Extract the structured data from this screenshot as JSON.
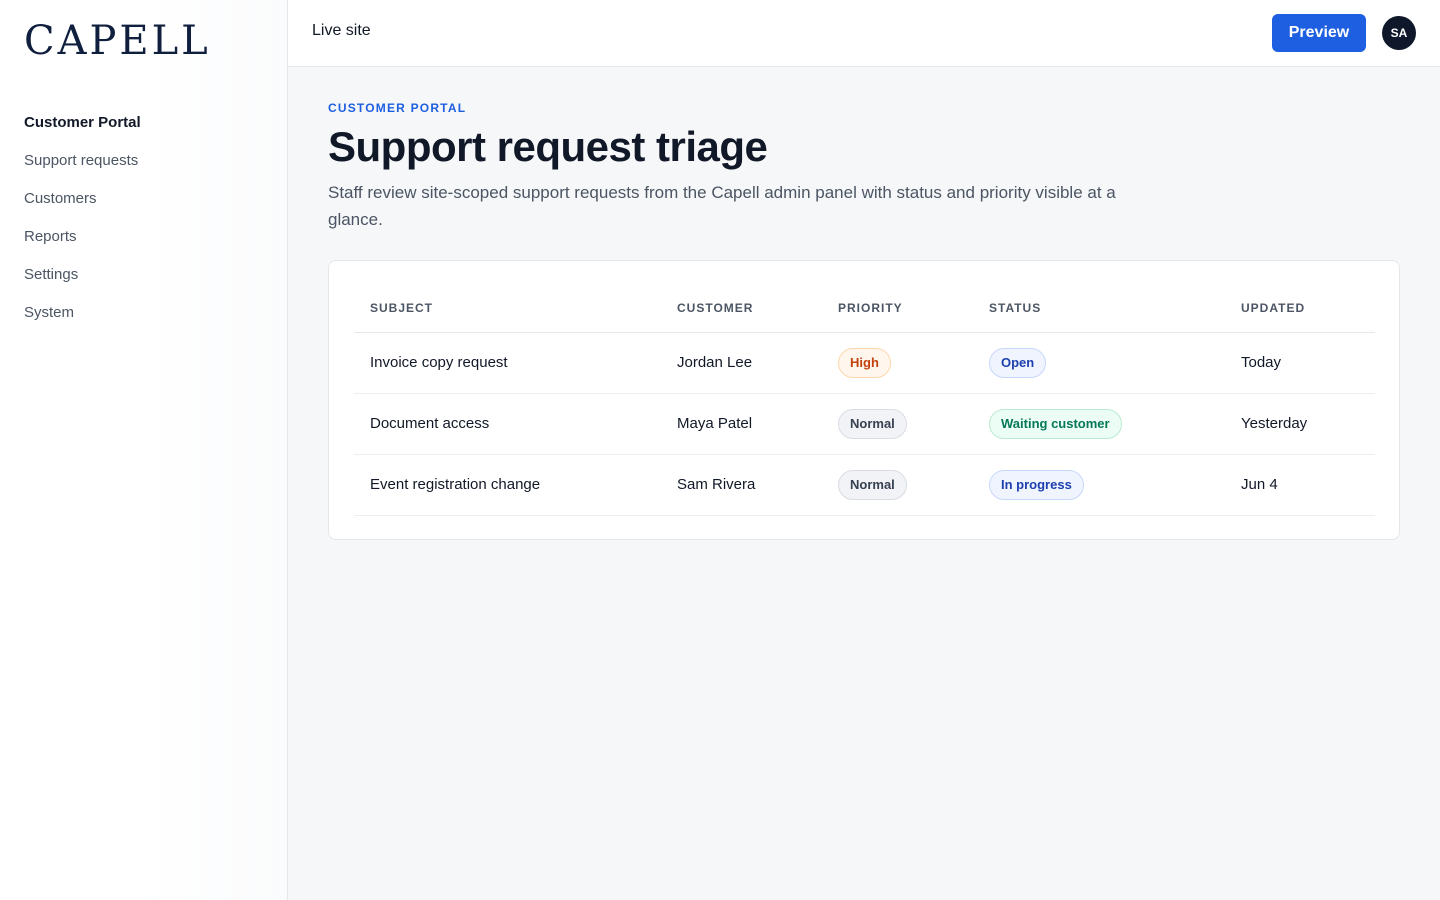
{
  "brand": {
    "logo_text": "CAPELL"
  },
  "sidebar": {
    "items": [
      {
        "label": "Customer Portal",
        "active": true
      },
      {
        "label": "Support requests"
      },
      {
        "label": "Customers"
      },
      {
        "label": "Reports"
      },
      {
        "label": "Settings"
      },
      {
        "label": "System"
      }
    ]
  },
  "topbar": {
    "live_site": "Live site",
    "preview_label": "Preview",
    "avatar_initials": "SA"
  },
  "page": {
    "eyebrow": "CUSTOMER PORTAL",
    "title": "Support request triage",
    "description": "Staff review site-scoped support requests from the Capell admin panel with status and priority visible at a glance."
  },
  "table": {
    "headers": [
      "SUBJECT",
      "CUSTOMER",
      "PRIORITY",
      "STATUS",
      "UPDATED"
    ],
    "rows": [
      {
        "subject": "Invoice copy request",
        "customer": "Jordan Lee",
        "priority": "High",
        "status": "Open",
        "updated": "Today"
      },
      {
        "subject": "Document access",
        "customer": "Maya Patel",
        "priority": "Normal",
        "status": "Waiting customer",
        "updated": "Yesterday"
      },
      {
        "subject": "Event registration change",
        "customer": "Sam Rivera",
        "priority": "Normal",
        "status": "In progress",
        "updated": "Jun 4"
      }
    ]
  },
  "colors": {
    "accent": "#1d5fe0",
    "priority_high": "#c2410c",
    "status_open": "#1e40af",
    "status_waiting": "#047857"
  }
}
